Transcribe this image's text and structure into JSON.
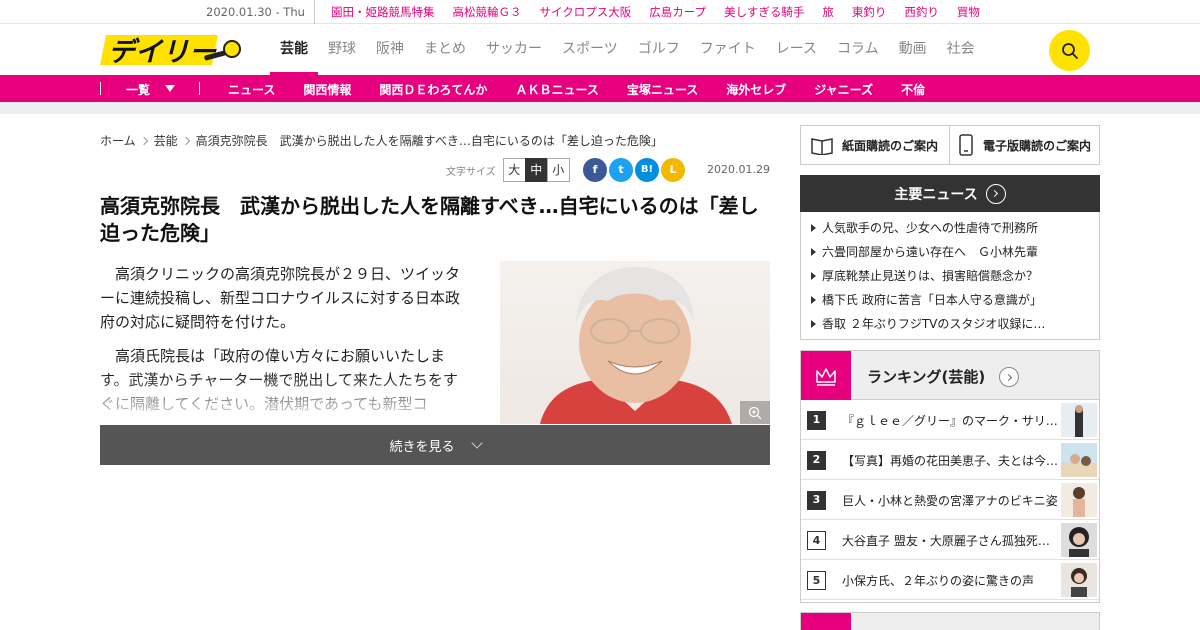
{
  "topbar": {
    "date": "2020.01.30 - Thu",
    "links": [
      "園田・姫路競馬特集",
      "高松競輪Ｇ３",
      "サイクロプス大阪",
      "広島カープ",
      "美しすぎる騎手",
      "旅",
      "東釣り",
      "西釣り",
      "買物"
    ]
  },
  "header": {
    "logo_text": "デイリー",
    "nav": [
      "芸能",
      "野球",
      "阪神",
      "まとめ",
      "サッカー",
      "スポーツ",
      "ゴルフ",
      "ファイト",
      "レース",
      "コラム",
      "動画",
      "社会"
    ],
    "active_nav": "芸能",
    "search_icon": "search-icon"
  },
  "subnav": {
    "ichiran": "一覧",
    "items": [
      "ニュース",
      "関西情報",
      "関西ＤＥわろてんか",
      "ＡＫＢニュース",
      "宝塚ニュース",
      "海外セレブ",
      "ジャニーズ",
      "不倫"
    ]
  },
  "breadcrumb": [
    "ホーム",
    "芸能",
    "高須克弥院長　武漢から脱出した人を隔離すべき…自宅にいるのは「差し迫った危険」"
  ],
  "tools": {
    "font_size_label": "文字サイズ",
    "sizes": [
      "大",
      "中",
      "小"
    ],
    "selected_size": "中",
    "share": {
      "facebook": "f",
      "twitter": "t",
      "hatena": "B!",
      "line": "L"
    },
    "date": "2020.01.29"
  },
  "article": {
    "headline": "高須克弥院長　武漢から脱出した人を隔離すべき…自宅にいるのは「差し迫った危険」",
    "paragraphs": [
      "高須クリニックの高須克弥院長が２９日、ツイッターに連続投稿し、新型コロナウイルスに対する日本政府の対応に疑問符を付けた。",
      "高須氏院長は「政府の偉い方々にお願いいたします。武漢からチャーター機で脱出して来た人たちをすぐに隔離してください。潜伏期であっても新型コ"
    ],
    "photo_alt": "高須克弥院長",
    "more_label": "続きを見る"
  },
  "sidebar": {
    "paper_subscribe": "紙面購読のご案内",
    "digital_subscribe": "電子版購読のご案内",
    "main_news_title": "主要ニュース",
    "main_news": [
      "人気歌手の兄、少女への性虐待で刑務所",
      "六畳同部屋から遠い存在へ　Ｇ小林先輩",
      "厚底靴禁止見送りは、損害賠償懸念か？",
      "橋下氏 政府に苦言「日本人守る意識が」",
      "香取 ２年ぶりフジTVのスタジオ収録に…"
    ],
    "ranking_title": "ランキング(芸能)",
    "ranking": [
      {
        "rank": "1",
        "title": "『ｇｌｅｅ／グリー』のマーク・サリ…"
      },
      {
        "rank": "2",
        "title": "【写真】再婚の花田美恵子、夫とは今…"
      },
      {
        "rank": "3",
        "title": "巨人・小林と熱愛の宮澤アナのビキニ姿"
      },
      {
        "rank": "4",
        "title": "大谷直子 盟友・大原麗子さん孤独死…"
      },
      {
        "rank": "5",
        "title": "小保方氏、２年ぶりの姿に驚きの声"
      }
    ]
  },
  "colors": {
    "brand_pink": "#e6007e",
    "search_yellow": "#ffe200",
    "dark": "#333333"
  }
}
